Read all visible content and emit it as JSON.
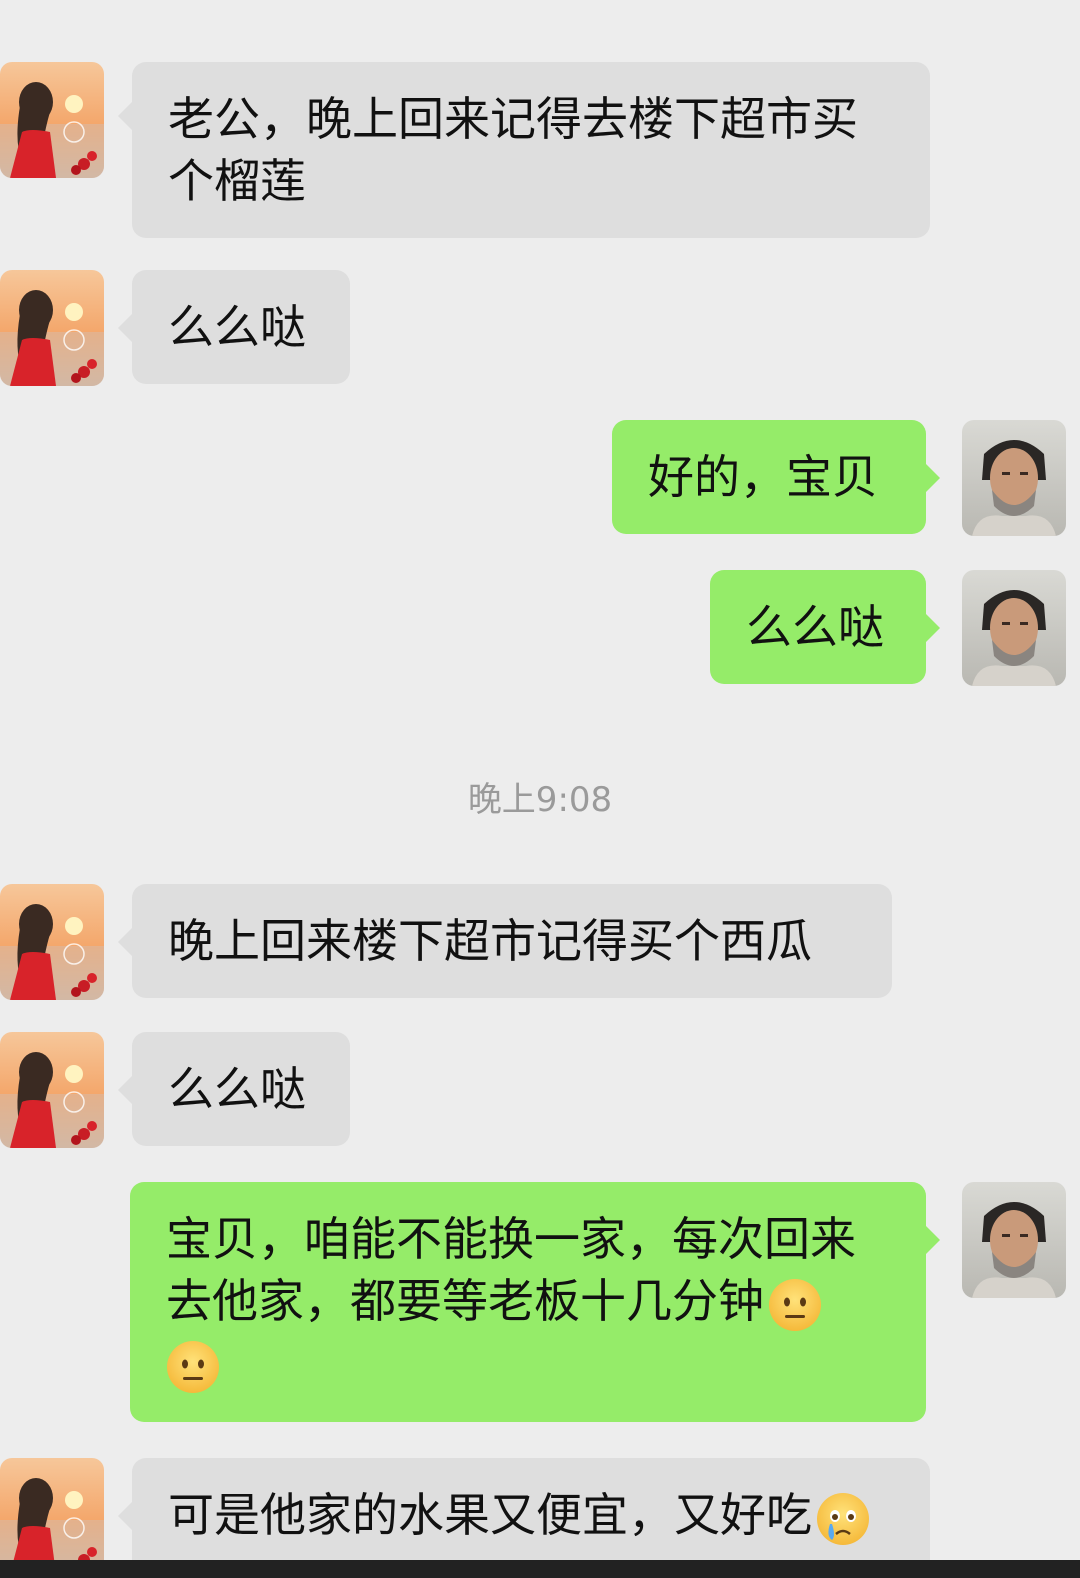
{
  "chat": {
    "messages": [
      {
        "side": "left",
        "text_lines": [
          "老公，晚上回来记得去楼下超市买",
          "个榴莲"
        ]
      },
      {
        "side": "left",
        "text_lines": [
          "么么哒"
        ]
      },
      {
        "side": "right",
        "text_lines": [
          "好的，宝贝"
        ]
      },
      {
        "side": "right",
        "text_lines": [
          "么么哒"
        ]
      },
      {
        "side": "left",
        "text_lines": [
          "晚上回来楼下超市记得买个西瓜"
        ]
      },
      {
        "side": "left",
        "text_lines": [
          "么么哒"
        ]
      },
      {
        "side": "right",
        "text_lines": [
          "宝贝，咱能不能换一家，每次回来",
          "去他家，都要等老板十几分钟"
        ]
      },
      {
        "side": "left",
        "text_lines": [
          "可是他家的水果又便宜，又好吃"
        ]
      }
    ],
    "timestamp": "晚上9:08"
  },
  "icons": {
    "neutral_face": "neutral-face-emoji-icon",
    "crying_face": "crying-face-emoji-icon",
    "avatar_woman": "woman-avatar",
    "avatar_man": "man-avatar"
  },
  "colors": {
    "background": "#ededed",
    "incoming_bubble": "#dedede",
    "outgoing_bubble": "#95ec69"
  }
}
